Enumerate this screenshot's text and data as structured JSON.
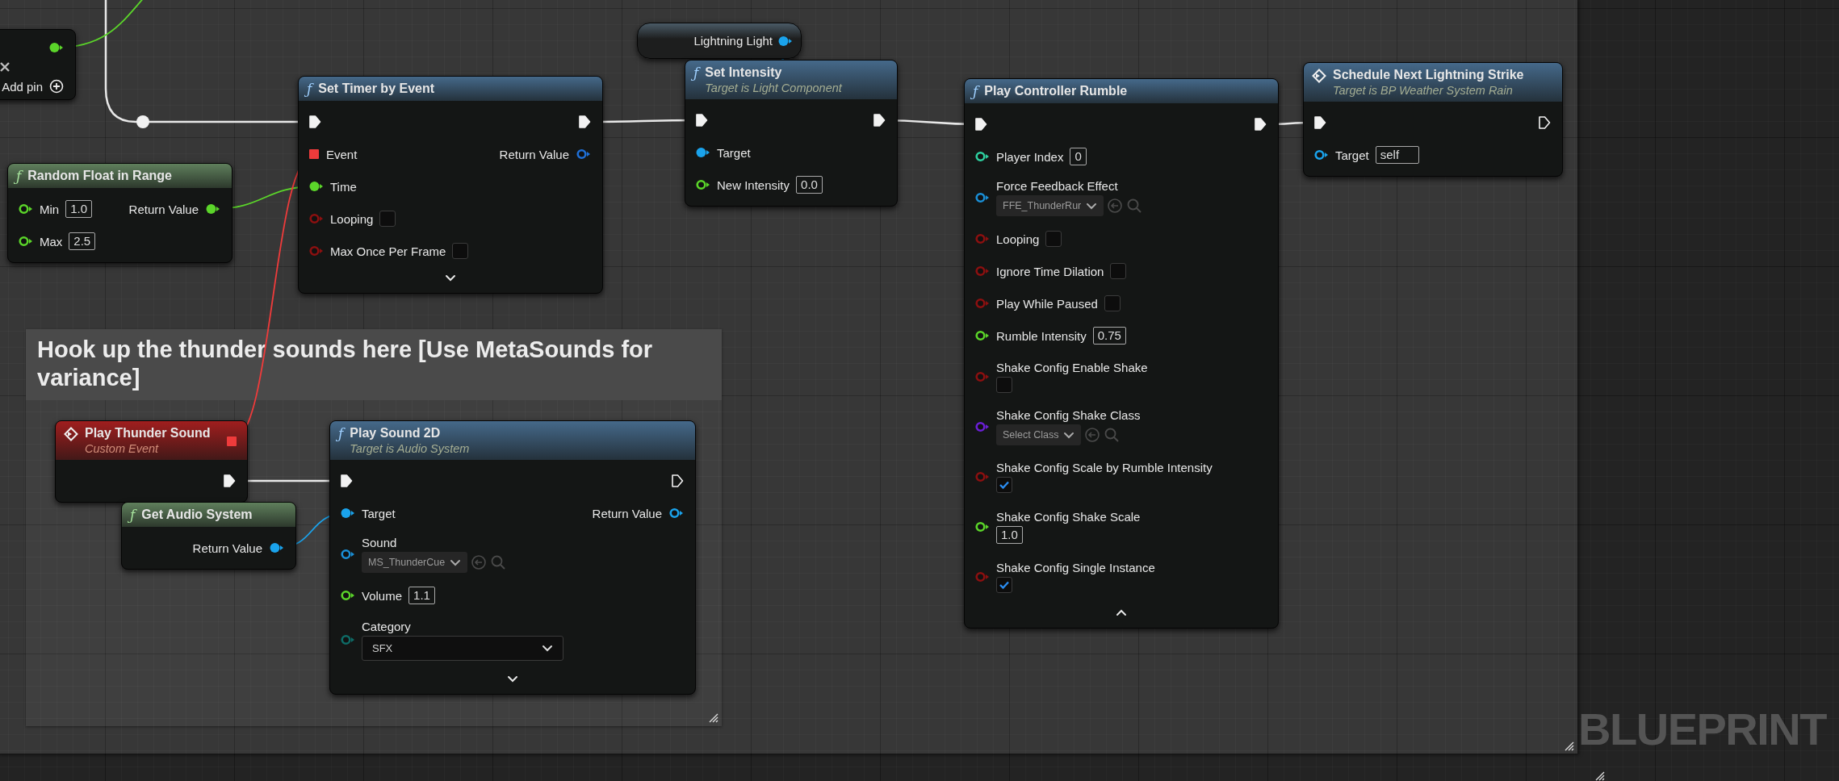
{
  "graph_label": "BLUEPRINT",
  "comments": [
    {
      "title": "Hook up the thunder sounds here [Use MetaSounds for variance]"
    }
  ],
  "nodes": [
    {
      "kind": "partial",
      "rows": [
        {
          "kind": "pin",
          "out": {
            "kind": "data",
            "color": "#5bd52a",
            "connected": true
          }
        },
        {
          "kind": "remove_pin"
        },
        {
          "kind": "add_pin",
          "label": "Add pin"
        }
      ]
    },
    {
      "kind": "function",
      "glyph": "ƒ",
      "title": "Set Timer by Event",
      "color": "#45698a",
      "advanced_expanded": false,
      "rows": [
        {
          "kind": "exec",
          "in": {
            "connected": true
          },
          "out": {
            "connected": true
          }
        },
        {
          "kind": "pin",
          "in": {
            "kind": "delegate",
            "label": "Event",
            "color": "#ee3b3b",
            "connected": true
          },
          "out": {
            "kind": "data",
            "label": "Return Value",
            "color": "#1f6fd6",
            "connected": false
          }
        },
        {
          "kind": "pin",
          "in": {
            "kind": "data",
            "label": "Time",
            "color": "#5bd52a",
            "connected": true
          }
        },
        {
          "kind": "pin",
          "in": {
            "kind": "data",
            "label": "Looping",
            "color": "#8c1010",
            "connected": false,
            "field": {
              "kind": "checkbox",
              "checked": false
            }
          }
        },
        {
          "kind": "pin",
          "in": {
            "kind": "data",
            "label": "Max Once Per Frame",
            "color": "#8c1010",
            "connected": false,
            "field": {
              "kind": "checkbox",
              "checked": false
            }
          }
        }
      ]
    },
    {
      "kind": "pure",
      "glyph": "ƒ",
      "title": "Random Float in Range",
      "color": "#5f7f5c",
      "rows": [
        {
          "kind": "pin",
          "in": {
            "kind": "data",
            "label": "Min",
            "color": "#5bd52a",
            "connected": false,
            "field": {
              "kind": "number",
              "value": "1.0"
            }
          },
          "out": {
            "kind": "data",
            "label": "Return Value",
            "color": "#5bd52a",
            "connected": true
          }
        },
        {
          "kind": "pin",
          "in": {
            "kind": "data",
            "label": "Max",
            "color": "#5bd52a",
            "connected": false,
            "field": {
              "kind": "number",
              "value": "2.5"
            }
          }
        }
      ]
    },
    {
      "kind": "variable",
      "title": "Lightning Light",
      "pin": {
        "kind": "data",
        "color": "#1aa3ec",
        "connected": true
      }
    },
    {
      "kind": "function",
      "glyph": "ƒ",
      "title": "Set Intensity",
      "subtitle": "Target is Light Component",
      "color": "#45698a",
      "rows": [
        {
          "kind": "exec",
          "in": {
            "connected": true
          },
          "out": {
            "connected": true
          }
        },
        {
          "kind": "pin",
          "in": {
            "kind": "data",
            "label": "Target",
            "color": "#1aa3ec",
            "connected": true
          }
        },
        {
          "kind": "pin",
          "in": {
            "kind": "data",
            "label": "New Intensity",
            "color": "#5bd52a",
            "connected": false,
            "field": {
              "kind": "number",
              "value": "0.0"
            }
          }
        }
      ]
    },
    {
      "kind": "function",
      "glyph": "ƒ",
      "title": "Play Controller Rumble",
      "color": "#45698a",
      "advanced_expanded": true,
      "rows": [
        {
          "kind": "exec",
          "in": {
            "connected": true
          },
          "out": {
            "connected": true
          }
        },
        {
          "kind": "pin",
          "in": {
            "kind": "data",
            "label": "Player Index",
            "color": "#2ecf9f",
            "connected": false,
            "field": {
              "kind": "number",
              "value": "0"
            }
          }
        },
        {
          "kind": "stacked_pin",
          "in": {
            "kind": "data",
            "label": "Force Feedback Effect",
            "color": "#1a8fd6",
            "connected": false,
            "field": {
              "kind": "asset",
              "value": "FFE_ThunderRur"
            }
          }
        },
        {
          "kind": "pin",
          "in": {
            "kind": "data",
            "label": "Looping",
            "color": "#8c1010",
            "connected": false,
            "field": {
              "kind": "checkbox",
              "checked": false
            }
          }
        },
        {
          "kind": "pin",
          "in": {
            "kind": "data",
            "label": "Ignore Time Dilation",
            "color": "#8c1010",
            "connected": false,
            "field": {
              "kind": "checkbox",
              "checked": false
            }
          }
        },
        {
          "kind": "pin",
          "in": {
            "kind": "data",
            "label": "Play While Paused",
            "color": "#8c1010",
            "connected": false,
            "field": {
              "kind": "checkbox",
              "checked": false
            }
          }
        },
        {
          "kind": "pin",
          "in": {
            "kind": "data",
            "label": "Rumble Intensity",
            "color": "#5bd52a",
            "connected": false,
            "field": {
              "kind": "number",
              "value": "0.75"
            }
          }
        },
        {
          "kind": "stacked_pin",
          "in": {
            "kind": "data",
            "label": "Shake Config Enable Shake",
            "color": "#8c1010",
            "connected": false,
            "field": {
              "kind": "checkbox",
              "checked": false
            }
          }
        },
        {
          "kind": "stacked_pin",
          "in": {
            "kind": "data",
            "label": "Shake Config Shake Class",
            "color": "#6b1fd6",
            "connected": false,
            "field": {
              "kind": "asset",
              "value": "Select Class"
            }
          }
        },
        {
          "kind": "stacked_pin",
          "in": {
            "kind": "data",
            "label": "Shake Config Scale by Rumble Intensity",
            "color": "#8c1010",
            "connected": false,
            "field": {
              "kind": "checkbox",
              "checked": true
            }
          }
        },
        {
          "kind": "stacked_pin",
          "in": {
            "kind": "data",
            "label": "Shake Config Shake Scale",
            "color": "#5bd52a",
            "connected": false,
            "field": {
              "kind": "number",
              "value": "1.0"
            }
          }
        },
        {
          "kind": "stacked_pin",
          "in": {
            "kind": "data",
            "label": "Shake Config Single Instance",
            "color": "#8c1010",
            "connected": false,
            "field": {
              "kind": "checkbox",
              "checked": true
            }
          }
        }
      ]
    },
    {
      "kind": "event_call",
      "title": "Schedule Next Lightning Strike",
      "subtitle": "Target is BP Weather System Rain",
      "color": "#45698a",
      "rows": [
        {
          "kind": "exec",
          "in": {
            "connected": true
          },
          "out": {
            "connected": false
          }
        },
        {
          "kind": "pin",
          "in": {
            "kind": "data",
            "label": "Target",
            "color": "#1aa3ec",
            "connected": false,
            "field": {
              "kind": "text",
              "value": "self"
            }
          }
        }
      ]
    },
    {
      "kind": "event",
      "title": "Play Thunder Sound",
      "subtitle": "Custom Event",
      "color": "#a01e1e",
      "delegate": {
        "color": "#ee3b3b",
        "connected": true
      },
      "rows": [
        {
          "kind": "exec",
          "out": {
            "connected": true
          }
        }
      ]
    },
    {
      "kind": "pure",
      "glyph": "ƒ",
      "title": "Get Audio System",
      "color": "#5f7f5c",
      "rows": [
        {
          "kind": "pin",
          "out": {
            "kind": "data",
            "label": "Return Value",
            "color": "#1aa3ec",
            "connected": true
          }
        }
      ]
    },
    {
      "kind": "function",
      "glyph": "ƒ",
      "title": "Play Sound 2D",
      "subtitle": "Target is Audio System",
      "color": "#45698a",
      "advanced_expanded": false,
      "rows": [
        {
          "kind": "exec",
          "in": {
            "connected": true
          },
          "out": {
            "connected": false
          }
        },
        {
          "kind": "pin",
          "in": {
            "kind": "data",
            "label": "Target",
            "color": "#1aa3ec",
            "connected": true
          },
          "out": {
            "kind": "data",
            "label": "Return Value",
            "color": "#1aa3ec",
            "connected": false
          }
        },
        {
          "kind": "stacked_pin",
          "in": {
            "kind": "data",
            "label": "Sound",
            "color": "#1a8fd6",
            "connected": false,
            "field": {
              "kind": "asset",
              "value": "MS_ThunderCue"
            }
          }
        },
        {
          "kind": "pin",
          "in": {
            "kind": "data",
            "label": "Volume",
            "color": "#5bd52a",
            "connected": false,
            "field": {
              "kind": "number",
              "value": "1.1"
            }
          }
        },
        {
          "kind": "stacked_pin",
          "in": {
            "kind": "data",
            "label": "Category",
            "color": "#0e6b66",
            "connected": false,
            "field": {
              "kind": "select",
              "value": "SFX"
            }
          }
        }
      ]
    }
  ]
}
